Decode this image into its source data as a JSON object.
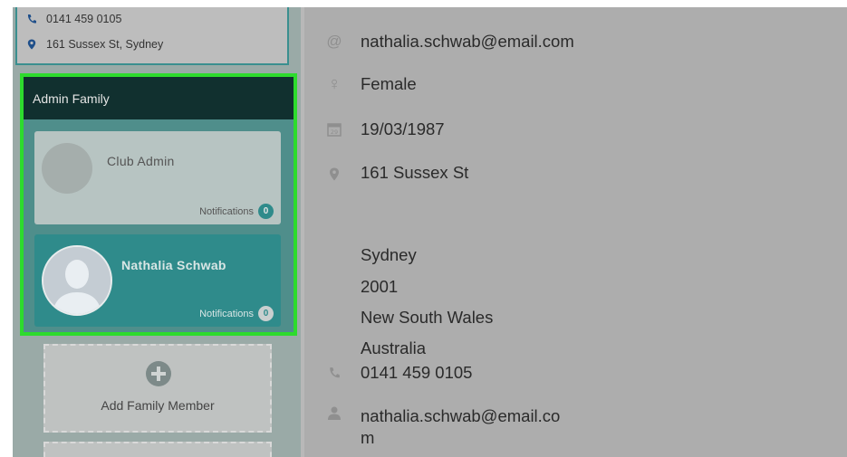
{
  "contact": {
    "phone": "0141 459 0105",
    "address": "161 Sussex St, Sydney"
  },
  "family": {
    "title": "Admin Family",
    "members": [
      {
        "name": "Club Admin",
        "notifications_label": "Notifications",
        "notifications_count": "0"
      },
      {
        "name": "Nathalia Schwab",
        "notifications_label": "Notifications",
        "notifications_count": "0"
      }
    ],
    "add_member_label": "Add Family Member"
  },
  "details": {
    "email": "nathalia.schwab@email.com",
    "gender": "Female",
    "dob": "19/03/1987",
    "street": "161 Sussex St",
    "city": "Sydney",
    "postcode": "2001",
    "state": "New South Wales",
    "country": "Australia",
    "phone": "0141 459 0105",
    "username_line1": "nathalia.schwab@email.co",
    "username_line2": "m"
  },
  "colors": {
    "highlight": "#2ddb2d",
    "accent": "#2f8b8b",
    "header": "#11302f"
  },
  "icons": {
    "calendar_day": "29"
  }
}
